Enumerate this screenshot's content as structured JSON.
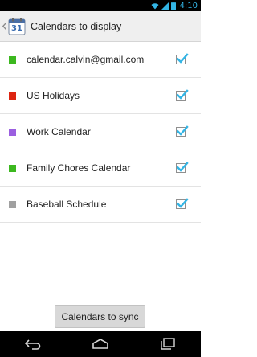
{
  "status_bar": {
    "time": "4:10",
    "accent_color": "#33b5e5",
    "icons": [
      "wifi-icon",
      "signal-icon",
      "battery-icon"
    ]
  },
  "action_bar": {
    "app_icon_text": "31",
    "title": "Calendars to display",
    "icon": "calendar-app-icon"
  },
  "calendars": [
    {
      "label": "calendar.calvin@gmail.com",
      "color": "#3cb81f",
      "checked": true
    },
    {
      "label": "US Holidays",
      "color": "#dd2411",
      "checked": true
    },
    {
      "label": "Work Calendar",
      "color": "#9b5fe0",
      "checked": true
    },
    {
      "label": "Family Chores Calendar",
      "color": "#3cb81f",
      "checked": true
    },
    {
      "label": "Baseball Schedule",
      "color": "#a0a0a0",
      "checked": true
    }
  ],
  "footer": {
    "sync_button_label": "Calendars to sync"
  },
  "nav_bar": {
    "buttons": [
      "back-icon",
      "home-icon",
      "recent-apps-icon"
    ]
  },
  "colors": {
    "check_color": "#33b5e5",
    "action_bar_bg": "#efefef"
  }
}
